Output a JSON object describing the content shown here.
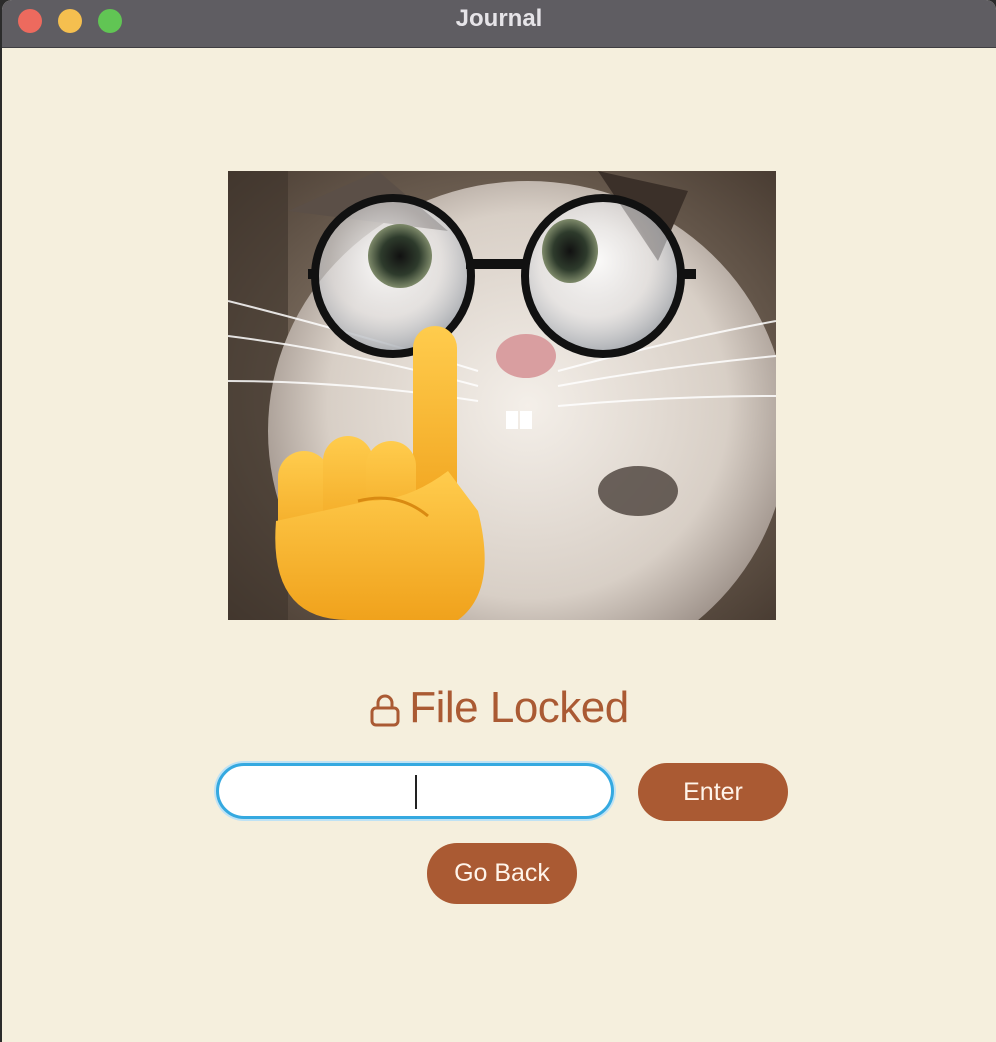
{
  "window": {
    "title": "Journal",
    "controls": [
      "close",
      "minimize",
      "maximize"
    ]
  },
  "image": {
    "alt": "Cat wearing round glasses with a shushing finger emoji"
  },
  "lock": {
    "icon": "lock-icon",
    "label": "File Locked"
  },
  "password_input": {
    "value": "",
    "placeholder": ""
  },
  "buttons": {
    "enter": "Enter",
    "go_back": "Go Back"
  },
  "colors": {
    "background": "#f5efdd",
    "accent": "#aa5a33",
    "focus_ring": "#35a9e0",
    "titlebar": "#5f5d62"
  }
}
